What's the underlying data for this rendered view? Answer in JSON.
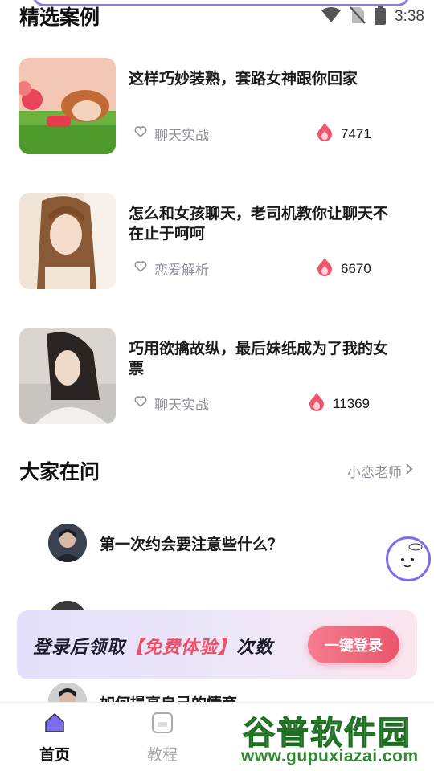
{
  "status_bar": {
    "time": "3:38"
  },
  "featured": {
    "title": "精选案例",
    "cases": [
      {
        "title": "这样巧妙装熟，套路女神跟你回家",
        "tag": "聊天实战",
        "count": "7471"
      },
      {
        "title": "怎么和女孩聊天，老司机教你让聊天不在止于呵呵",
        "tag": "恋爱解析",
        "count": "6670"
      },
      {
        "title": "巧用欲擒故纵，最后妹纸成为了我的女票",
        "tag": "聊天实战",
        "count": "11369"
      }
    ]
  },
  "questions": {
    "title": "大家在问",
    "more_label": "小恋老师",
    "items": [
      {
        "text": "第一次约会要注意些什么？"
      },
      {
        "text": ""
      },
      {
        "text": "如何提高自己的情商"
      }
    ]
  },
  "login_banner": {
    "text_prefix": "登录后领取",
    "text_highlight": "【免费体验】",
    "text_suffix": "次数",
    "button_label": "一键登录"
  },
  "tab_bar": {
    "tabs": [
      {
        "label": "首页",
        "active": true
      },
      {
        "label": "教程",
        "active": false
      }
    ]
  },
  "watermark": {
    "title": "谷普软件园",
    "url": "www.gupuxiazai.com"
  },
  "colors": {
    "accent": "#e9566c",
    "primary": "#7b6cf0",
    "tag_gray": "#8c8c9a"
  }
}
